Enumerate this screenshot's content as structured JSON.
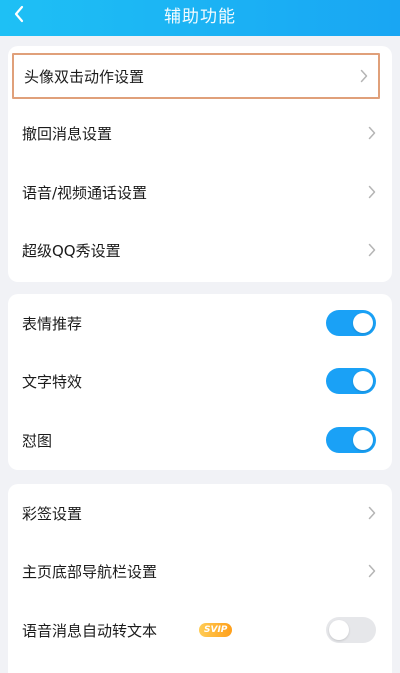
{
  "header": {
    "title": "辅助功能",
    "back_icon": "chevron-left-icon",
    "gradient": [
      "#1ec0f5",
      "#19a6f3"
    ]
  },
  "group1": {
    "items": [
      {
        "label": "头像双击动作设置",
        "selected": true
      },
      {
        "label": "撤回消息设置"
      },
      {
        "label": "语音/视频通话设置"
      },
      {
        "label": "超级QQ秀设置"
      }
    ]
  },
  "group2": {
    "items": [
      {
        "label": "表情推荐",
        "on": true
      },
      {
        "label": "文字特效",
        "on": true
      },
      {
        "label": "怼图",
        "on": true
      }
    ]
  },
  "group3": {
    "items": [
      {
        "label": "彩签设置"
      },
      {
        "label": "主页底部导航栏设置"
      },
      {
        "label": "语音消息自动转文本",
        "badge": "SVIP",
        "on": false
      }
    ]
  },
  "colors": {
    "accent": "#1aa1f6",
    "page_bg": "#f1f2f6",
    "selection_border": "#e0a07a"
  }
}
